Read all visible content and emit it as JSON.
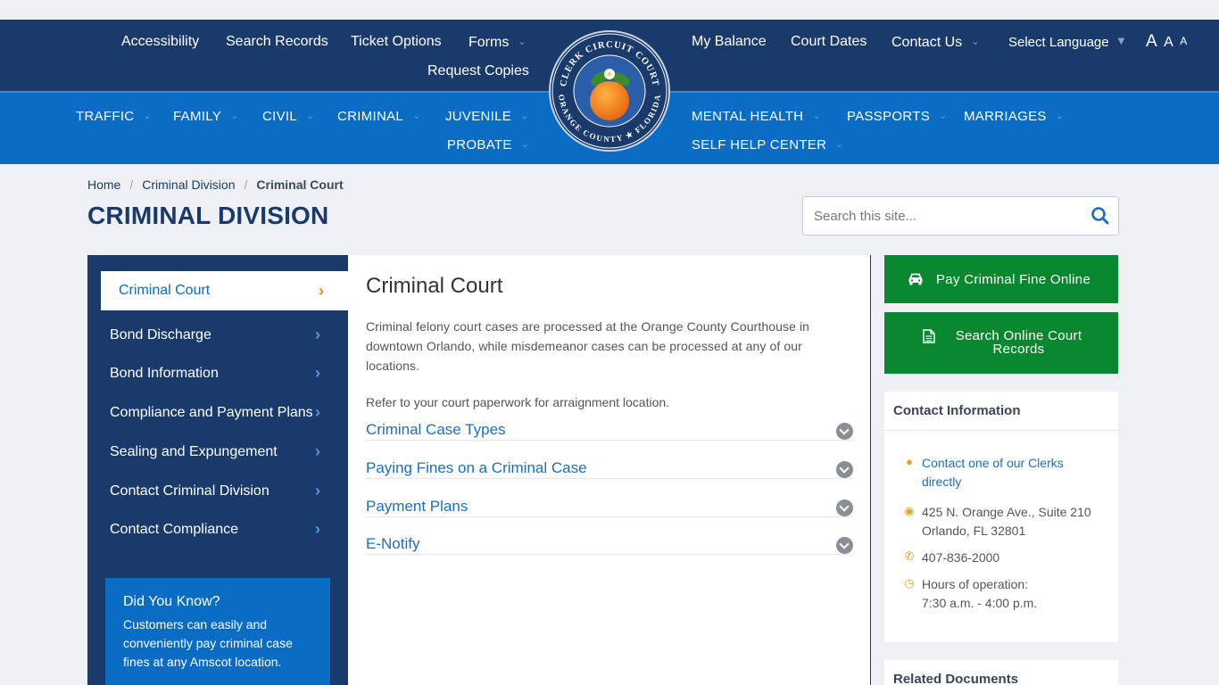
{
  "top_nav": {
    "accessibility": "Accessibility",
    "search_records": "Search Records",
    "ticket_options": "Ticket Options",
    "forms": "Forms",
    "request_copies": "Request Copies",
    "my_balance": "My Balance",
    "court_dates": "Court Dates",
    "contact_us": "Contact Us",
    "select_language": "Select Language",
    "font_sizes": [
      "A",
      "A",
      "A"
    ]
  },
  "seal": {
    "top_text": "CLERK CIRCUIT COURT",
    "bottom_text": "ORANGE COUNTY ★ FLORIDA"
  },
  "main_nav": {
    "traffic": "TRAFFIC",
    "family": "FAMILY",
    "civil": "CIVIL",
    "criminal": "CRIMINAL",
    "juvenile": "JUVENILE",
    "probate": "PROBATE",
    "mental_health": "MENTAL HEALTH",
    "passports": "PASSPORTS",
    "marriages": "MARRIAGES",
    "self_help_center": "SELF HELP CENTER"
  },
  "breadcrumb": {
    "home": "Home",
    "division": "Criminal Division",
    "current": "Criminal Court",
    "separator": "/"
  },
  "page_title": "CRIMINAL DIVISION",
  "search": {
    "placeholder": "Search this site..."
  },
  "sidebar": {
    "active": "Criminal Court",
    "items": [
      "Bond Discharge",
      "Bond Information",
      "Compliance and Payment Plans",
      "Sealing and Expungement",
      "Contact Criminal Division",
      "Contact Compliance"
    ],
    "did_you_know": {
      "title": "Did You Know?",
      "body": "Customers can easily and conveniently pay criminal case fines at any Amscot location."
    }
  },
  "main": {
    "title": "Criminal Court",
    "paragraph1": "Criminal felony court cases are processed at the Orange County Courthouse in downtown Orlando, while misdemeanor cases can be processed at any of our locations.",
    "paragraph2": "Refer to your court paperwork for arraignment location.",
    "accordion": [
      "Criminal Case Types",
      "Paying Fines on a Criminal Case",
      "Payment Plans",
      "E-Notify"
    ]
  },
  "right": {
    "pay_button": "Pay Criminal Fine Online",
    "search_button_line1": "Search Online Court",
    "search_button_line2": "Records",
    "contact": {
      "title": "Contact Information",
      "link_line1": "Contact one of our Clerks",
      "link_line2": "directly",
      "address_line1": "425 N. Orange Ave., Suite 210",
      "address_line2": "Orlando, FL 32801",
      "phone": "407-836-2000",
      "hours_line1": "Hours of operation:",
      "hours_line2": "7:30 a.m. - 4:00 p.m."
    },
    "related_docs_title": "Related Documents"
  },
  "colors": {
    "header_dark": "#1a3a6b",
    "header_blue": "#0a6cc2",
    "green_button": "#09872f",
    "accent_orange": "#e8872a"
  }
}
